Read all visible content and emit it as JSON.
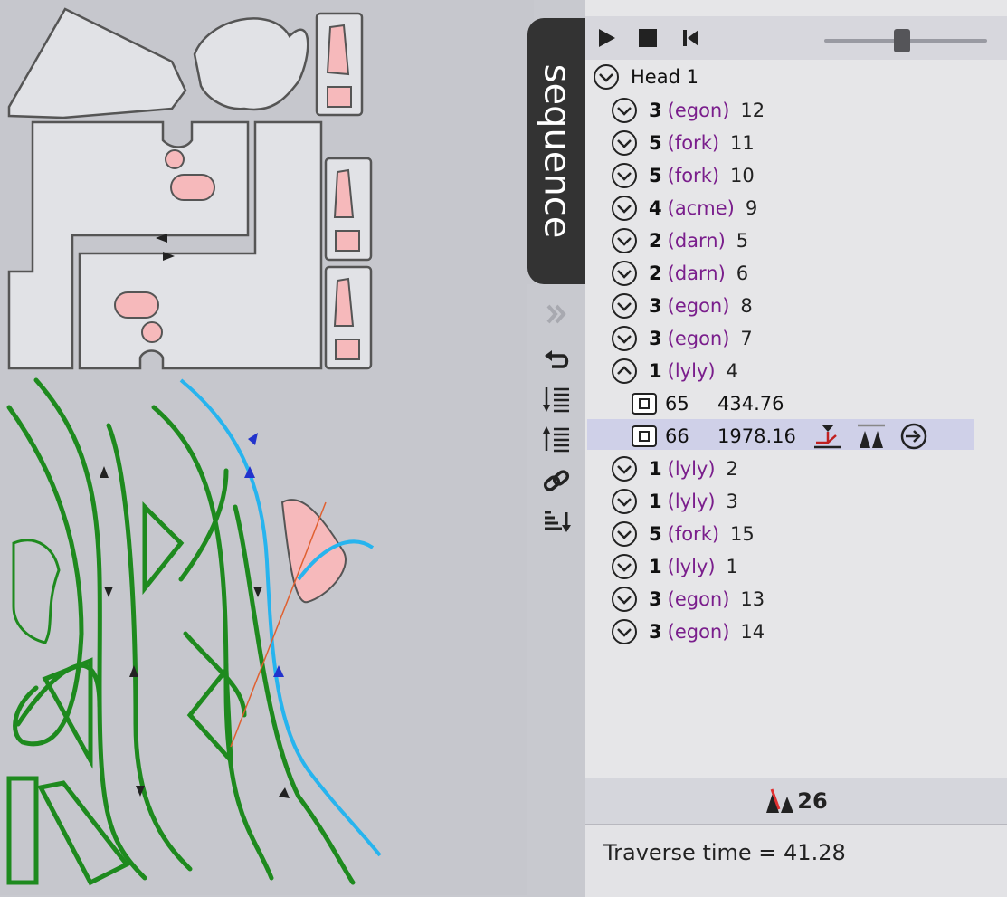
{
  "sidebar": {
    "tab_label": "sequence"
  },
  "tree": {
    "root_label": "Head 1",
    "groups": [
      {
        "count": "3",
        "name": "(egon)",
        "id": "12"
      },
      {
        "count": "5",
        "name": "(fork)",
        "id": "11"
      },
      {
        "count": "5",
        "name": "(fork)",
        "id": "10"
      },
      {
        "count": "4",
        "name": "(acme)",
        "id": "9"
      },
      {
        "count": "2",
        "name": "(darn)",
        "id": "5"
      },
      {
        "count": "2",
        "name": "(darn)",
        "id": "6"
      },
      {
        "count": "3",
        "name": "(egon)",
        "id": "8"
      },
      {
        "count": "3",
        "name": "(egon)",
        "id": "7"
      },
      {
        "count": "1",
        "name": "(lyly)",
        "id": "4"
      }
    ],
    "children": [
      {
        "id": "65",
        "value": "434.76"
      },
      {
        "id": "66",
        "value": "1978.16"
      }
    ],
    "groups_after": [
      {
        "count": "1",
        "name": "(lyly)",
        "id": "2"
      },
      {
        "count": "1",
        "name": "(lyly)",
        "id": "3"
      },
      {
        "count": "5",
        "name": "(fork)",
        "id": "15"
      },
      {
        "count": "1",
        "name": "(lyly)",
        "id": "1"
      },
      {
        "count": "3",
        "name": "(egon)",
        "id": "13"
      },
      {
        "count": "3",
        "name": "(egon)",
        "id": "14"
      }
    ]
  },
  "tool_count": "26",
  "traverse_time": "Traverse time = 41.28",
  "slider_value": 0.48,
  "colors": {
    "accent_purple": "#7a1e8c",
    "selection": "#cfd0e8",
    "green_path": "#1e8a1e",
    "cyan_path": "#27b4ee",
    "pink_hole": "#f6b9bb"
  },
  "icons": {
    "play": "play-icon",
    "stop": "stop-icon",
    "rewind": "skip-back-icon",
    "chevron_down": "chevron-down-icon",
    "chevron_up": "chevron-up-icon",
    "part": "part-icon",
    "pierce": "pierce-icon",
    "tool": "tool-icon",
    "lead": "lead-in-icon"
  }
}
